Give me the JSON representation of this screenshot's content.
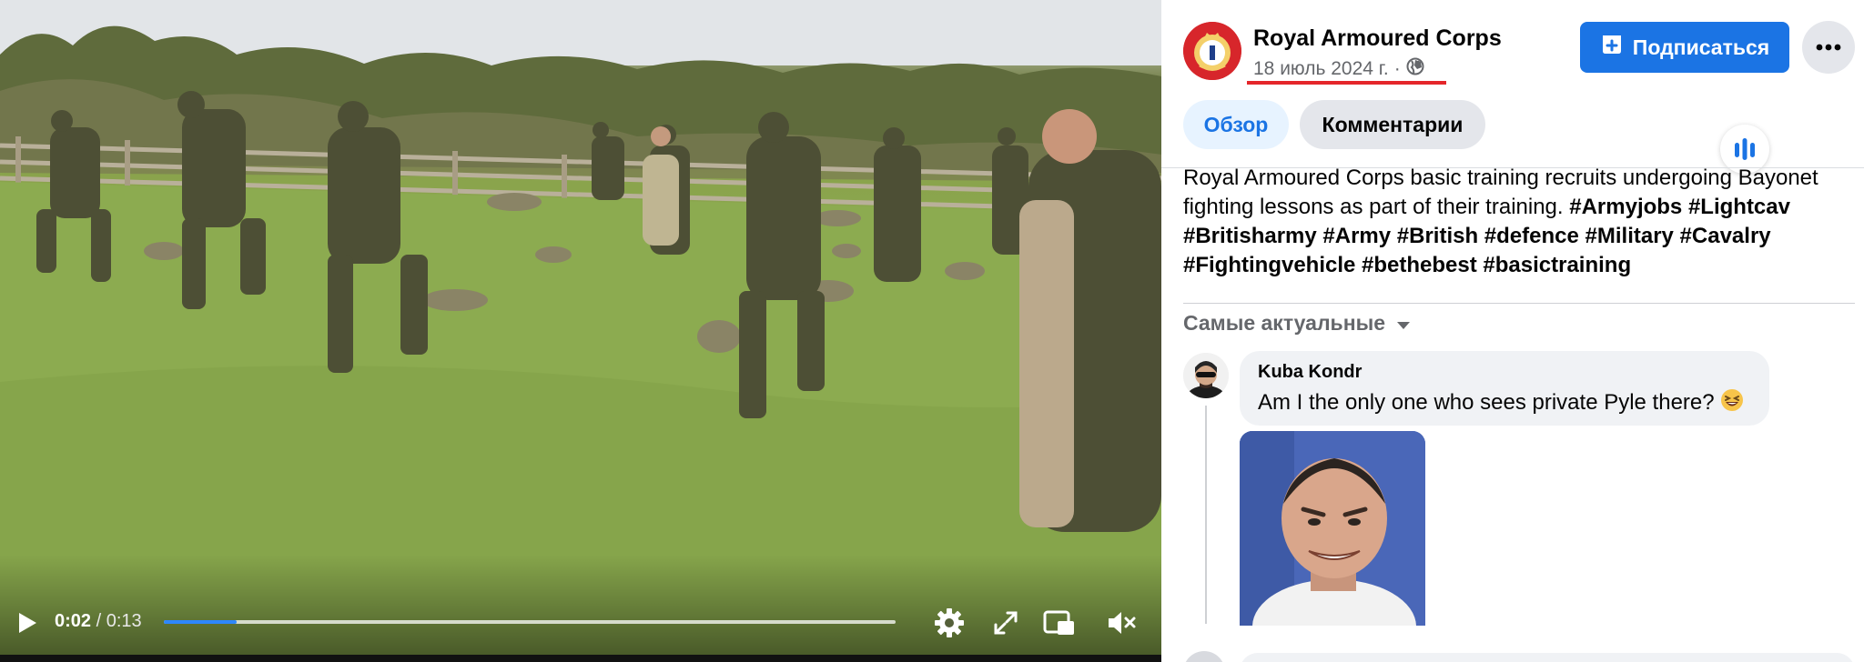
{
  "video": {
    "current_time": "0:02",
    "separator": "/",
    "duration": "0:13",
    "progress_fraction": 0.1,
    "icons": {
      "play": "play-icon",
      "settings": "gear-icon",
      "fullscreen": "fullscreen-icon",
      "pip": "picture-in-picture-icon",
      "mute": "muted-speaker-icon"
    },
    "colors": {
      "progress": "#2d88ff"
    }
  },
  "post": {
    "page_name": "Royal Armoured Corps",
    "date": "18 июль 2024 г.",
    "meta_separator": "·",
    "audience_icon": "globe-icon",
    "follow_label": "Подписаться",
    "follow_icon": "follow-icon",
    "more_icon": "more-dots-icon",
    "tabs": [
      {
        "label": "Обзор",
        "active": true
      },
      {
        "label": "Комментарии",
        "active": false
      }
    ],
    "audio_icon": "audio-wave-icon",
    "description_text": "Royal Armoured Corps basic training recruits undergoing Bayonet fighting lessons as part of their training.",
    "description_tags": "#Armyjobs #Lightcav #Britisharmy #Army #British #defence #Military #Cavalry #Fightingvehicle #bethebest #basictraining",
    "colors": {
      "brand": "#1b74e4",
      "annotation": "#e4262a"
    }
  },
  "comments": {
    "sort_label": "Самые актуальные",
    "items": [
      {
        "author": "Kuba Kondr",
        "text": "Am I the only one who sees private Pyle there?",
        "emoji": "grinning-squinting-face"
      }
    ]
  }
}
